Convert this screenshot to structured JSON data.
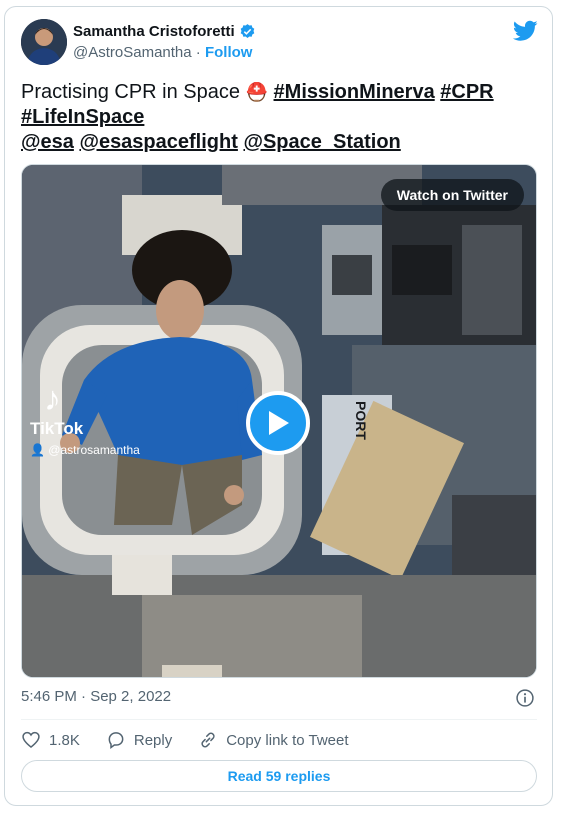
{
  "author": {
    "name": "Samantha Cristoforetti",
    "handle": "@AstroSamantha",
    "separator": " · ",
    "follow_label": "Follow"
  },
  "tweet": {
    "plain": "Practising CPR in Space ",
    "emoji": "⛑️",
    "hashtags": [
      "#MissionMinerva",
      "#CPR",
      "#LifeInSpace"
    ],
    "mentions": [
      "@esa",
      "@esaspaceflight",
      "@Space_Station"
    ]
  },
  "media": {
    "watch_label": "Watch on Twitter",
    "tiktok_label": "TikTok",
    "tiktok_user": "@astrosamantha"
  },
  "meta": {
    "timestamp": "5:46 PM · Sep 2, 2022"
  },
  "actions": {
    "likes": "1.8K",
    "reply_label": "Reply",
    "copy_label": "Copy link to Tweet"
  },
  "replies_button": "Read 59 replies",
  "colors": {
    "accent": "#1d9bf0",
    "text": "#0f1419",
    "secondary": "#536471",
    "border": "#cfd9de"
  }
}
